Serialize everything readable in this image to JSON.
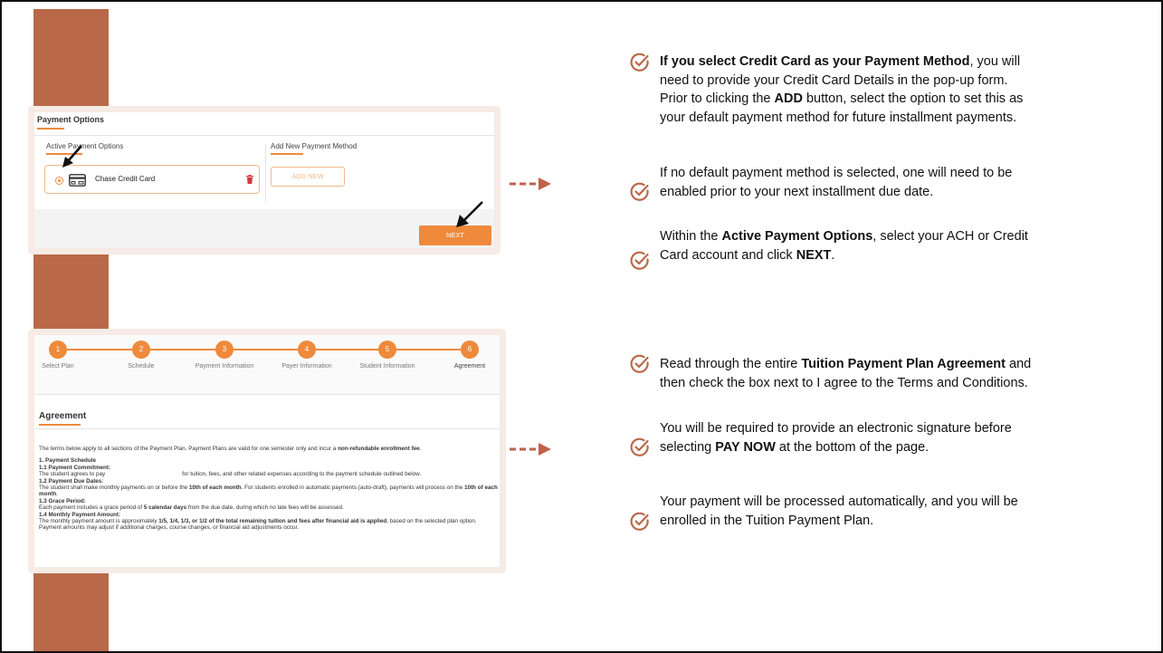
{
  "colors": {
    "sidebar": "#b9694a",
    "accent": "#ef8a3c",
    "arrow": "#c0614a",
    "check": "#b9694a"
  },
  "payment_options": {
    "title": "Payment Options",
    "active_header": "Active Payment Options",
    "add_header": "Add New Payment Method",
    "card_label": "Chase Credit Card",
    "add_new_label": "ADD NEW",
    "next_label": "NEXT",
    "card_icon": "credit-card-icon",
    "delete_icon": "trash-icon"
  },
  "agreement": {
    "steps": [
      {
        "num": "1",
        "label": "Select Plan"
      },
      {
        "num": "2",
        "label": "Schedule"
      },
      {
        "num": "3",
        "label": "Payment Information"
      },
      {
        "num": "4",
        "label": "Payer Information"
      },
      {
        "num": "5",
        "label": "Student Information"
      },
      {
        "num": "6",
        "label": "Agreement"
      }
    ],
    "title": "Agreement",
    "intro_pre": "The terms below apply to all sections of the Payment Plan. Payment Plans are valid for one semester only and incur a ",
    "intro_bold": "non-refundable enrollment fee",
    "intro_post": ".",
    "s1": "1. Payment Schedule",
    "s11": "1.1 Payment Commitment:",
    "s11_text1": "The student agrees to pay",
    "s11_text2": "for tuition, fees, and other related expenses according to the payment schedule outlined below.",
    "s12": "1.2 Payment Due Dates:",
    "s12_pre": "The student shall make monthly payments on or before the ",
    "s12_bold": "10th of each month",
    "s12_mid": ". For students enrolled in automatic payments (auto-draft), payments will process on the ",
    "s12_bold2": "10th of each month",
    "s12_post": ".",
    "s13": "1.3 Grace Period:",
    "s13_pre": "Each payment includes a grace period of ",
    "s13_bold": "5 calendar days",
    "s13_post": " from the due date, during which no late fees will be assessed.",
    "s14": "1.4 Monthly Payment Amount:",
    "s14_pre": "The monthly payment amount is approximately ",
    "s14_bold": "1/5, 1/4, 1/3, or 1/2 of the total remaining tuition and fees after financial aid is applied",
    "s14_post": ", based on the selected plan option. Payment amounts may adjust if additional charges, course changes, or financial aid adjustments occur."
  },
  "notes": {
    "n1_bold": "If you select Credit Card as your Payment Method",
    "n1_rest1": ", you will",
    "n1_line2": "need to provide your Credit Card Details in the pop-up form.",
    "n1_line3_pre": "Prior to clicking the ",
    "n1_line3_bold": "ADD",
    "n1_line3_post": " button, select the option to set this as",
    "n1_line4": "your default payment method for future installment payments.",
    "n2_line1": "If no default payment method is selected, one will need to be",
    "n2_line2": "enabled prior to your next installment due date.",
    "n3_pre": "Within the ",
    "n3_bold": "Active Payment Options",
    "n3_post": ", select your ACH or Credit",
    "n3_line2_pre": "Card account and click ",
    "n3_line2_bold": "NEXT",
    "n3_line2_post": ".",
    "n4_pre": "Read through the entire ",
    "n4_bold": "Tuition Payment Plan Agreement",
    "n4_post": " and",
    "n4_line2": "then check the box next to I agree to the Terms and Conditions.",
    "n5_line1": "You will be required to provide an electronic signature before",
    "n5_pre": "selecting ",
    "n5_bold": "PAY NOW",
    "n5_post": " at the bottom of the page.",
    "n6_line1": "Your payment will be processed automatically, and you will be",
    "n6_line2": "enrolled in the Tuition Payment Plan.",
    "check_icon": "check-circle-icon"
  }
}
